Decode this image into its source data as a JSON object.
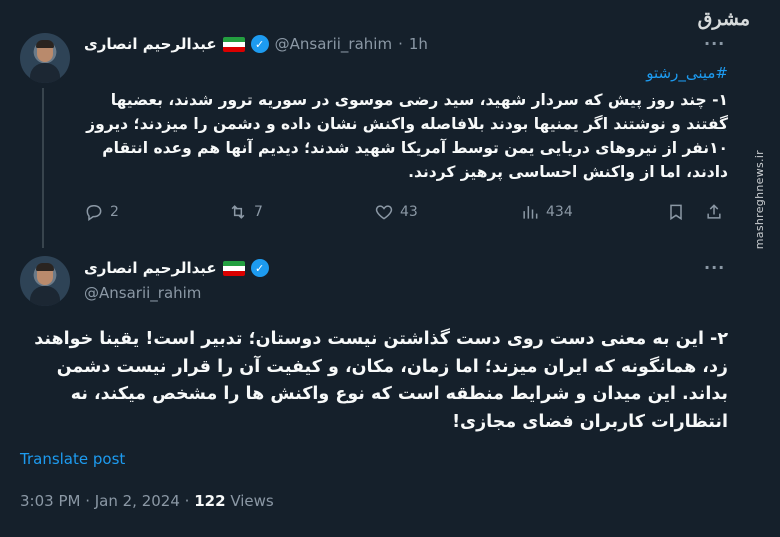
{
  "watermark": {
    "logo_text": "مشرق",
    "side_text": "mashreghnews.ir"
  },
  "tweet1": {
    "author_name": "عبدالرحیم انصاری",
    "handle": "@Ansarii_rahim",
    "dot": "·",
    "time": "1h",
    "more": "···",
    "hashtag": "#مینی_رشتو",
    "body": "۱- چند روز پیش که سردار شهید، سید رضی موسوی در سوریه ترور شدند، بعضیها گفتند و نوشتند اگر یمنیها بودند بلافاصله واکنش نشان داده و دشمن را میزدند؛ دیروز ۱۰نفر از نیروهای دریایی یمن توسط آمریکا شهید شدند؛ دیدیم آنها هم وعده انتقام دادند، اما از واکنش احساسی پرهیز کردند.",
    "actions": {
      "replies": "2",
      "reposts": "7",
      "likes": "43",
      "views": "434"
    },
    "icons": [
      "reply-icon",
      "repost-icon",
      "like-icon",
      "views-icon",
      "bookmark-icon",
      "share-icon"
    ]
  },
  "tweet2": {
    "author_name": "عبدالرحیم انصاری",
    "handle": "@Ansarii_rahim",
    "more": "···",
    "body": "۲- این به معنی دست روی دست گذاشتن نیست دوستان؛ تدبیر است! یقینا خواهند زد، همانگونه که ایران میزند؛ اما زمان، مکان، و کیفیت آن را قرار نیست دشمن بداند. این میدان و شرایط منطقه است که نوع واکنش ها را مشخص میکند، نه انتظارات کاربران فضای مجازی!",
    "translate_label": "Translate post",
    "timestamp": "3:03 PM · Jan 2, 2024 ·",
    "views_count": "122",
    "views_label": "Views"
  },
  "colors": {
    "background": "#15202b",
    "accent": "#1d9bf0",
    "muted": "#8b98a5",
    "text": "#f7f9f9",
    "thread_line": "#38444d"
  }
}
